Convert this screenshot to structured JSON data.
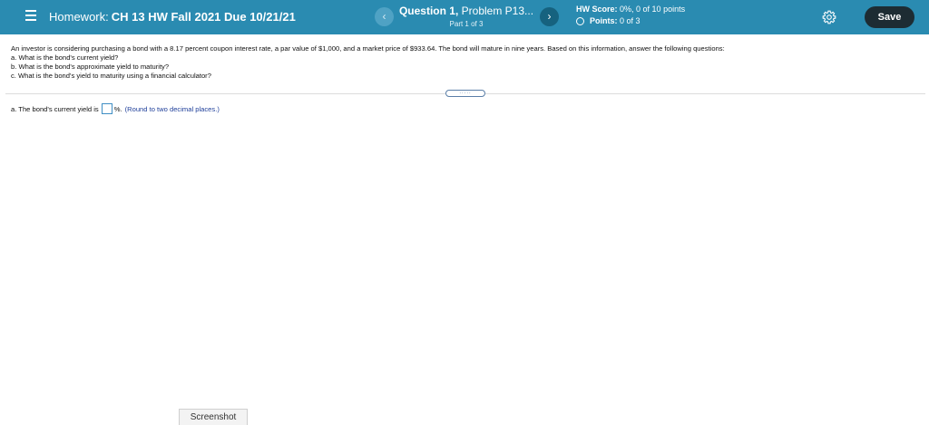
{
  "header": {
    "homework_prefix": "Homework:",
    "homework_name": "CH 13 HW Fall 2021 Due 10/21/21",
    "prev_icon": "‹",
    "next_icon": "›",
    "question_label": "Question 1,",
    "question_problem": "Problem P13...",
    "part": "Part 1 of 3",
    "hw_score_label": "HW Score:",
    "hw_score_value": "0%, 0 of 10 points",
    "points_label": "Points:",
    "points_value": "0 of 3",
    "save_label": "Save",
    "colors": {
      "bar": "#2a8bb1",
      "save": "#1d2c33"
    }
  },
  "problem": {
    "statement": "An investor is considering purchasing a bond with a 8.17 percent coupon interest rate, a par value of $1,000, and a market price of $933.64. The bond will mature in nine years. Based on this information, answer the following questions:",
    "a": "a. What is the bond's current yield?",
    "b": "b. What is the bond's approximate yield to maturity?",
    "c": "c. What is the bond's yield to maturity using a financial calculator?"
  },
  "toggle": {
    "label": "....."
  },
  "answer": {
    "prefix": "a. The bond's current yield is",
    "suffix": "%.",
    "hint": "(Round to two decimal places.)",
    "value": ""
  },
  "footer": {
    "screenshot_label": "Screenshot"
  }
}
